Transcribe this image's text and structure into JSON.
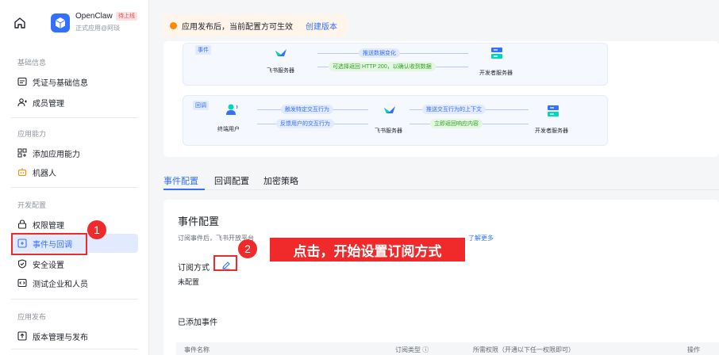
{
  "app": {
    "name": "OpenClaw",
    "badge": "待上线",
    "subtitle": "正式应用@阿琰"
  },
  "notice": {
    "text": "应用发布后，当前配置方可生效",
    "link": "创建版本"
  },
  "sidebar": {
    "groups": [
      {
        "title": "基础信息",
        "items": [
          "凭证与基础信息",
          "成员管理"
        ]
      },
      {
        "title": "应用能力",
        "items": [
          "添加应用能力",
          "机器人"
        ]
      },
      {
        "title": "开发配置",
        "items": [
          "权限管理",
          "事件与回调",
          "安全设置",
          "测试企业和人员"
        ]
      },
      {
        "title": "应用发布",
        "items": [
          "版本管理与发布"
        ]
      }
    ]
  },
  "diagram": {
    "event": {
      "tag": "事件",
      "source": "飞书服务器",
      "target": "开发者服务器",
      "push_label": "推送数据变化",
      "reply_label": "可选择返回 HTTP 200，以确认收到数据"
    },
    "callback": {
      "tag": "回调",
      "user": "终端用户",
      "server": "飞书服务器",
      "target": "开发者服务器",
      "trigger_label": "触发特定交互行为",
      "feedback_label": "反馈用户的交互行为",
      "push_context_label": "推送交互行为的上下文",
      "return_label": "立即返回响应内容"
    }
  },
  "tabs": [
    "事件配置",
    "回调配置",
    "加密策略"
  ],
  "config": {
    "title": "事件配置",
    "desc": "订阅事件后，飞书开放平台",
    "more_link": "了解更多",
    "subscribe_label": "订阅方式",
    "status": "未配置",
    "added_title": "已添加事件",
    "columns": [
      "事件名称",
      "订阅类型 ⓘ",
      "所需权限（开通以下任一权限即可）",
      "操作"
    ]
  },
  "annotations": {
    "marker1": "1",
    "marker2": "2",
    "callout": "点击，开始设置订阅方式"
  },
  "colors": {
    "accent": "#3370ff",
    "annotation": "#f02a2a",
    "notice_bg": "#fff5eb"
  }
}
